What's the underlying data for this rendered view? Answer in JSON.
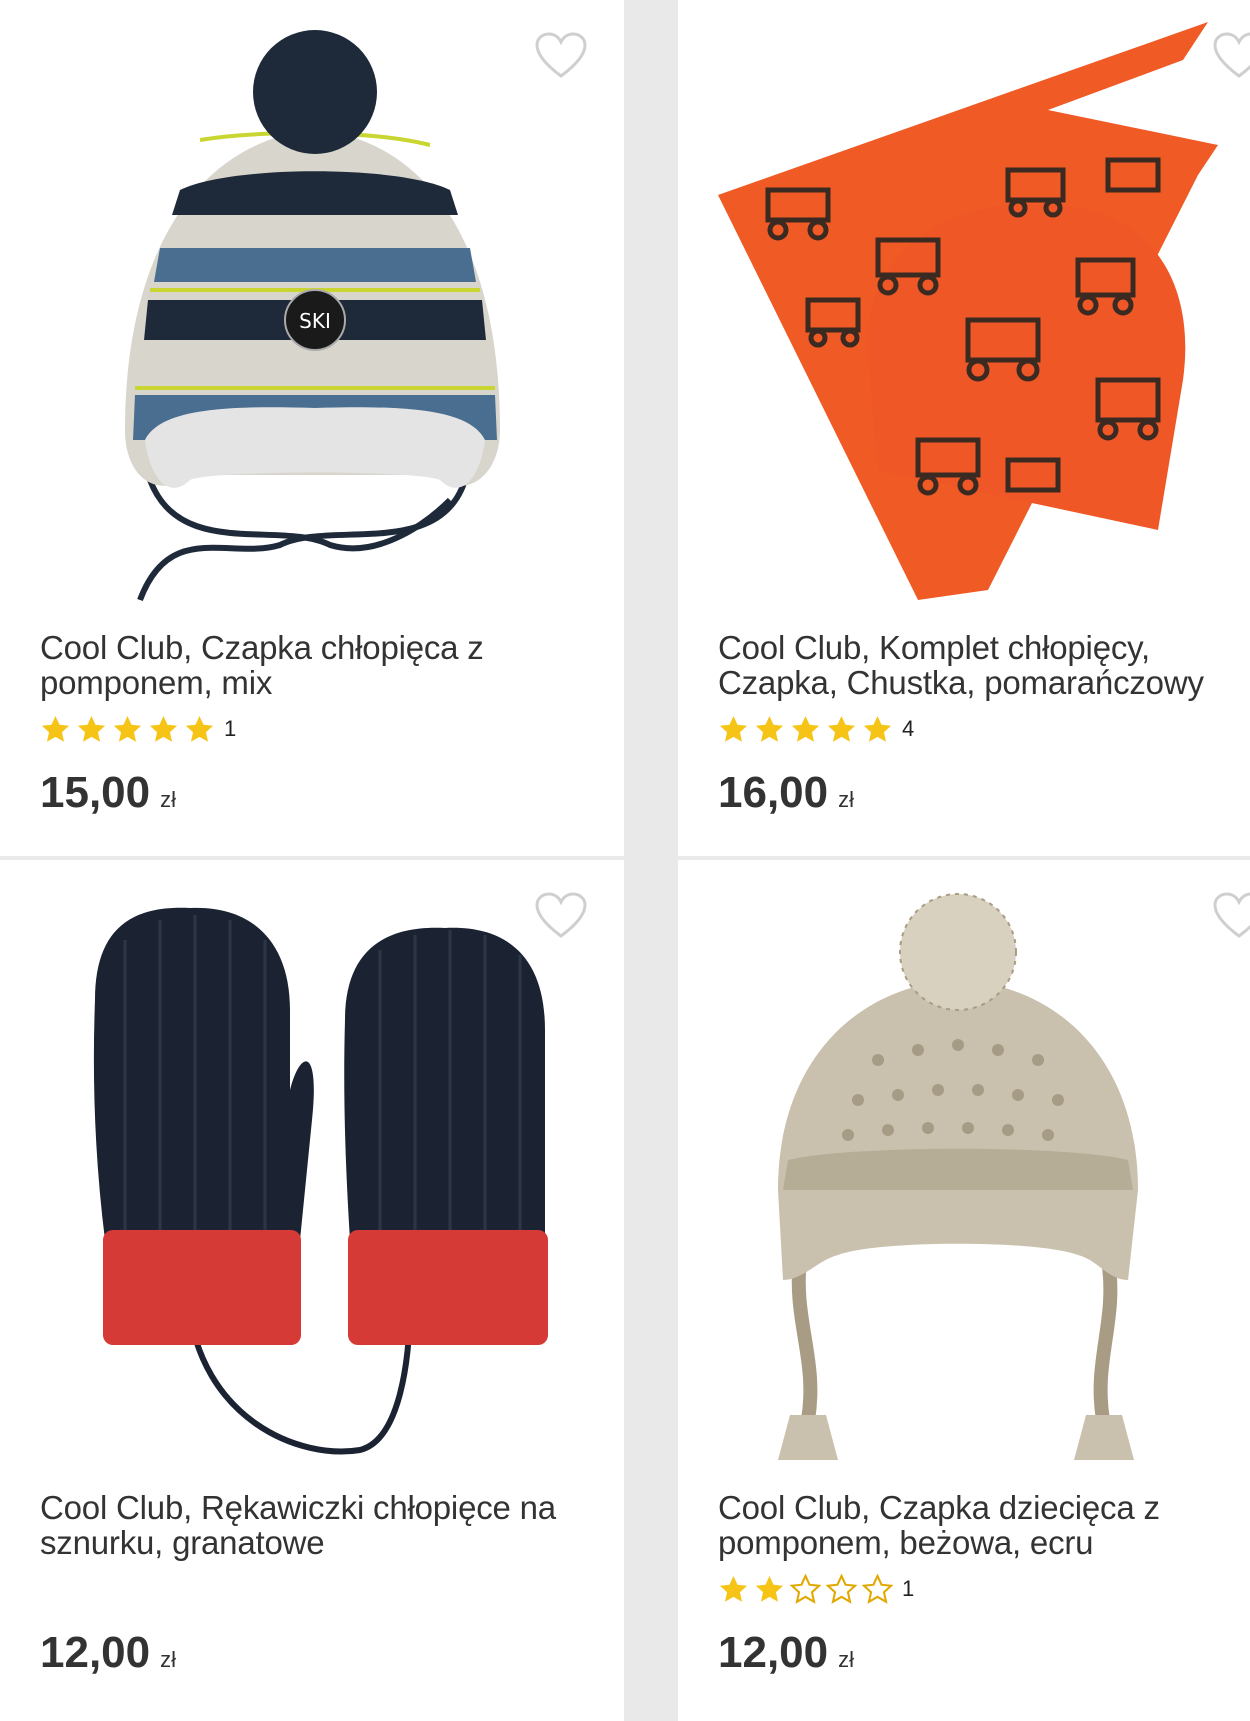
{
  "products": [
    {
      "title": "Cool Club, Czapka chłopięca z pomponem, mix",
      "rating": 5,
      "rating_count": "1",
      "price": "15,00",
      "currency": "zł",
      "image_colors": {
        "main": "#1e2a3a",
        "accent": "#4a6e90",
        "stripe": "#d8d5cc",
        "lime": "#c9d632"
      }
    },
    {
      "title": "Cool Club, Komplet chłopięcy, Czapka, Chustka, pomarańczowy",
      "rating": 5,
      "rating_count": "4",
      "price": "16,00",
      "currency": "zł",
      "image_colors": {
        "main": "#f05a24",
        "accent": "#3a2a22"
      }
    },
    {
      "title": "Cool Club, Rękawiczki chłopięce na sznurku, granatowe",
      "rating": null,
      "rating_count": "",
      "price": "12,00",
      "currency": "zł",
      "image_colors": {
        "main": "#1b2333",
        "accent": "#d63a36"
      }
    },
    {
      "title": "Cool Club, Czapka dziecięca z pomponem, beżowa, ecru",
      "rating": 2,
      "rating_count": "1",
      "price": "12,00",
      "currency": "zł",
      "image_colors": {
        "main": "#c9c1ad",
        "accent": "#8a7e68"
      }
    }
  ],
  "colors": {
    "star": "#f6c416",
    "star_empty_stroke": "#e0a800",
    "heart": "#cfcfcf"
  },
  "icons": {
    "wishlist": "heart-outline-icon",
    "rating": "star-icon"
  }
}
